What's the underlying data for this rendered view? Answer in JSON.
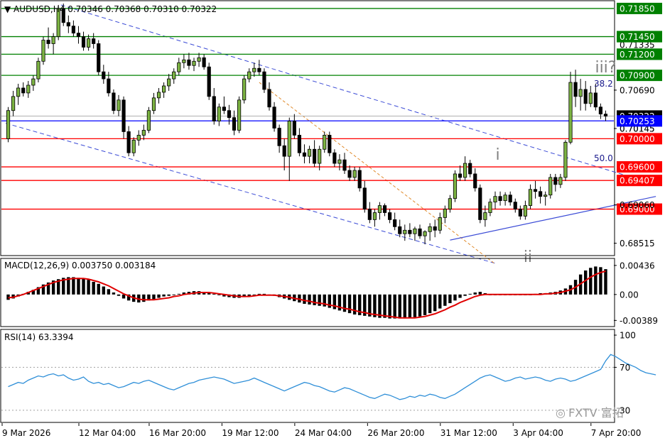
{
  "chart_data": [
    {
      "type": "candlestick",
      "symbol_header": "AUDUSD,H4",
      "ohlc_header": "0.70346 0.70368 0.70310 0.70322",
      "ylim": [
        0.6835,
        0.7195
      ],
      "price_ticks": [
        "0.70690",
        "0.70145",
        "0.69060",
        "0.68515"
      ],
      "x_labels": [
        "9 Mar 2026",
        "12 Mar 04:00",
        "16 Mar 20:00",
        "19 Mar 12:00",
        "24 Mar 04:00",
        "26 Mar 20:00",
        "31 Mar 12:00",
        "3 Apr 04:00",
        "7 Apr 20:00"
      ],
      "current_price": "0.70322",
      "horizontal_levels": [
        {
          "price": 0.7185,
          "label": "0.71850",
          "color": "#008000"
        },
        {
          "price": 0.7145,
          "label": "0.71450",
          "color": "#008000"
        },
        {
          "price": 0.712,
          "label": "0.71200",
          "color": "#008000"
        },
        {
          "price": 0.709,
          "label": "0.70900",
          "color": "#008000"
        },
        {
          "price": 0.70253,
          "label": "0.70253",
          "color": "#0000ff"
        },
        {
          "price": 0.7,
          "label": "0.70000",
          "color": "#ff0000"
        },
        {
          "price": 0.696,
          "label": "0.69600",
          "color": "#ff0000"
        },
        {
          "price": 0.69407,
          "label": "0.69407",
          "color": "#ff0000"
        },
        {
          "price": 0.69,
          "label": "0.69000",
          "color": "#ff0000"
        }
      ],
      "overlapped_tick_text": [
        "0.71335",
        "0.70145"
      ],
      "fib_labels": [
        {
          "text": "38.2",
          "price": 0.7078
        },
        {
          "text": "50.0",
          "price": 0.6972
        }
      ],
      "wave_labels": [
        {
          "text": "i",
          "price": 0.697
        },
        {
          "text": "ii",
          "price": 0.6825
        },
        {
          "text": "iii?",
          "price": 0.7094
        }
      ],
      "candles_ohlc": [
        [
          0.7,
          0.7045,
          0.6995,
          0.704
        ],
        [
          0.704,
          0.7068,
          0.7032,
          0.706
        ],
        [
          0.706,
          0.7078,
          0.7048,
          0.7072
        ],
        [
          0.7072,
          0.708,
          0.706,
          0.7065
        ],
        [
          0.7065,
          0.7082,
          0.7058,
          0.7076
        ],
        [
          0.7076,
          0.709,
          0.7068,
          0.7085
        ],
        [
          0.7085,
          0.7115,
          0.708,
          0.711
        ],
        [
          0.711,
          0.7145,
          0.7105,
          0.714
        ],
        [
          0.714,
          0.7158,
          0.7128,
          0.7135
        ],
        [
          0.7135,
          0.715,
          0.712,
          0.7145
        ],
        [
          0.7145,
          0.719,
          0.714,
          0.7185
        ],
        [
          0.7185,
          0.7192,
          0.716,
          0.7165
        ],
        [
          0.7165,
          0.7175,
          0.715,
          0.716
        ],
        [
          0.716,
          0.7168,
          0.7145,
          0.715
        ],
        [
          0.715,
          0.716,
          0.7135,
          0.7145
        ],
        [
          0.7145,
          0.7152,
          0.7125,
          0.713
        ],
        [
          0.713,
          0.7148,
          0.7125,
          0.7142
        ],
        [
          0.7142,
          0.715,
          0.7128,
          0.7135
        ],
        [
          0.7135,
          0.714,
          0.709,
          0.7095
        ],
        [
          0.7095,
          0.7105,
          0.7078,
          0.7085
        ],
        [
          0.7085,
          0.7095,
          0.706,
          0.7065
        ],
        [
          0.7065,
          0.707,
          0.7035,
          0.704
        ],
        [
          0.704,
          0.7062,
          0.7032,
          0.7055
        ],
        [
          0.7055,
          0.706,
          0.7,
          0.701
        ],
        [
          0.701,
          0.7018,
          0.6975,
          0.698
        ],
        [
          0.698,
          0.7002,
          0.6975,
          0.6998
        ],
        [
          0.6998,
          0.7012,
          0.699,
          0.7005
        ],
        [
          0.7005,
          0.702,
          0.6998,
          0.7012
        ],
        [
          0.7012,
          0.7045,
          0.7008,
          0.704
        ],
        [
          0.704,
          0.7065,
          0.7035,
          0.7058
        ],
        [
          0.7058,
          0.7072,
          0.705,
          0.7066
        ],
        [
          0.7066,
          0.708,
          0.7058,
          0.7075
        ],
        [
          0.7075,
          0.7092,
          0.7068,
          0.7085
        ],
        [
          0.7085,
          0.71,
          0.7078,
          0.7095
        ],
        [
          0.7095,
          0.7115,
          0.709,
          0.7108
        ],
        [
          0.7108,
          0.712,
          0.71,
          0.7112
        ],
        [
          0.7112,
          0.7122,
          0.7098,
          0.7104
        ],
        [
          0.7104,
          0.7115,
          0.7096,
          0.711
        ],
        [
          0.711,
          0.7122,
          0.7102,
          0.7115
        ],
        [
          0.7115,
          0.712,
          0.7098,
          0.7102
        ],
        [
          0.7102,
          0.7108,
          0.7055,
          0.706
        ],
        [
          0.706,
          0.7072,
          0.702,
          0.7025
        ],
        [
          0.7025,
          0.705,
          0.7018,
          0.7045
        ],
        [
          0.7045,
          0.706,
          0.7035,
          0.704
        ],
        [
          0.704,
          0.7048,
          0.702,
          0.703
        ],
        [
          0.703,
          0.704,
          0.7005,
          0.7012
        ],
        [
          0.7012,
          0.706,
          0.7008,
          0.7055
        ],
        [
          0.7055,
          0.709,
          0.705,
          0.7085
        ],
        [
          0.7085,
          0.71,
          0.708,
          0.7095
        ],
        [
          0.7095,
          0.7108,
          0.7088,
          0.71
        ],
        [
          0.71,
          0.7112,
          0.709,
          0.7095
        ],
        [
          0.7095,
          0.71,
          0.7065,
          0.707
        ],
        [
          0.707,
          0.708,
          0.704,
          0.7045
        ],
        [
          0.7045,
          0.7052,
          0.701,
          0.7015
        ],
        [
          0.7015,
          0.702,
          0.698,
          0.699
        ],
        [
          0.699,
          0.7,
          0.6955,
          0.6975
        ],
        [
          0.6975,
          0.703,
          0.694,
          0.7025
        ],
        [
          0.7025,
          0.7035,
          0.7,
          0.7005
        ],
        [
          0.7005,
          0.7015,
          0.6975,
          0.698
        ],
        [
          0.698,
          0.6992,
          0.6965,
          0.6975
        ],
        [
          0.6975,
          0.699,
          0.6965,
          0.6985
        ],
        [
          0.6985,
          0.6998,
          0.696,
          0.6965
        ],
        [
          0.6965,
          0.699,
          0.6955,
          0.6985
        ],
        [
          0.6985,
          0.701,
          0.698,
          0.7005
        ],
        [
          0.7005,
          0.701,
          0.6975,
          0.698
        ],
        [
          0.698,
          0.6985,
          0.696,
          0.6965
        ],
        [
          0.6965,
          0.6978,
          0.6955,
          0.697
        ],
        [
          0.697,
          0.698,
          0.695,
          0.6955
        ],
        [
          0.6955,
          0.6962,
          0.694,
          0.6945
        ],
        [
          0.6945,
          0.696,
          0.694,
          0.6955
        ],
        [
          0.6955,
          0.696,
          0.6925,
          0.693
        ],
        [
          0.693,
          0.694,
          0.6895,
          0.69
        ],
        [
          0.69,
          0.691,
          0.688,
          0.6885
        ],
        [
          0.6885,
          0.69,
          0.6875,
          0.6895
        ],
        [
          0.6895,
          0.691,
          0.6885,
          0.6905
        ],
        [
          0.6905,
          0.6908,
          0.689,
          0.6895
        ],
        [
          0.6895,
          0.69,
          0.688,
          0.6885
        ],
        [
          0.6885,
          0.6895,
          0.687,
          0.6875
        ],
        [
          0.6875,
          0.6885,
          0.686,
          0.6865
        ],
        [
          0.6865,
          0.6878,
          0.6855,
          0.687
        ],
        [
          0.687,
          0.688,
          0.686,
          0.6865
        ],
        [
          0.6865,
          0.6875,
          0.6855,
          0.6872
        ],
        [
          0.6872,
          0.6878,
          0.6858,
          0.6862
        ],
        [
          0.6862,
          0.687,
          0.685,
          0.6868
        ],
        [
          0.6868,
          0.688,
          0.6855,
          0.6875
        ],
        [
          0.6875,
          0.6885,
          0.686,
          0.687
        ],
        [
          0.687,
          0.6895,
          0.6865,
          0.6888
        ],
        [
          0.6888,
          0.6905,
          0.688,
          0.69
        ],
        [
          0.69,
          0.692,
          0.6895,
          0.6915
        ],
        [
          0.6915,
          0.6955,
          0.691,
          0.695
        ],
        [
          0.695,
          0.6962,
          0.694,
          0.6945
        ],
        [
          0.6945,
          0.6975,
          0.694,
          0.6965
        ],
        [
          0.6965,
          0.697,
          0.6945,
          0.695
        ],
        [
          0.695,
          0.6958,
          0.6925,
          0.693
        ],
        [
          0.693,
          0.6935,
          0.688,
          0.6885
        ],
        [
          0.6885,
          0.6905,
          0.6875,
          0.6895
        ],
        [
          0.6895,
          0.6915,
          0.689,
          0.691
        ],
        [
          0.691,
          0.6925,
          0.69,
          0.6918
        ],
        [
          0.6918,
          0.6925,
          0.6905,
          0.6912
        ],
        [
          0.6912,
          0.6924,
          0.6905,
          0.692
        ],
        [
          0.692,
          0.6925,
          0.6905,
          0.691
        ],
        [
          0.691,
          0.6915,
          0.6895,
          0.69
        ],
        [
          0.69,
          0.6905,
          0.6885,
          0.689
        ],
        [
          0.689,
          0.6912,
          0.6885,
          0.6905
        ],
        [
          0.6905,
          0.6935,
          0.69,
          0.6928
        ],
        [
          0.6928,
          0.694,
          0.6915,
          0.6925
        ],
        [
          0.6925,
          0.6932,
          0.6908,
          0.6918
        ],
        [
          0.6918,
          0.6925,
          0.6905,
          0.692
        ],
        [
          0.692,
          0.695,
          0.6915,
          0.6945
        ],
        [
          0.6945,
          0.695,
          0.6925,
          0.6935
        ],
        [
          0.6935,
          0.695,
          0.693,
          0.6945
        ],
        [
          0.6945,
          0.6998,
          0.694,
          0.6995
        ],
        [
          0.6995,
          0.7095,
          0.6992,
          0.708
        ],
        [
          0.708,
          0.7098,
          0.7045,
          0.706
        ],
        [
          0.706,
          0.7085,
          0.704,
          0.707
        ],
        [
          0.707,
          0.7082,
          0.704,
          0.705
        ],
        [
          0.705,
          0.7075,
          0.7045,
          0.7065
        ],
        [
          0.7065,
          0.7078,
          0.704,
          0.7045
        ],
        [
          0.7045,
          0.705,
          0.7028,
          0.7035
        ],
        [
          0.7035,
          0.704,
          0.7025,
          0.7032
        ]
      ]
    },
    {
      "type": "histogram",
      "header": "MACD(12,26,9) 0.003750 0.003184",
      "ylim": [
        -0.0046,
        0.0052
      ],
      "y_ticks": [
        "0.00436",
        "0.00",
        "-0.00389"
      ],
      "histogram": [
        -0.0008,
        -0.0006,
        -0.0003,
        0.0001,
        0.0004,
        0.0007,
        0.0011,
        0.0015,
        0.0018,
        0.0021,
        0.0023,
        0.0025,
        0.0026,
        0.0026,
        0.0025,
        0.0024,
        0.0022,
        0.0019,
        0.0016,
        0.0012,
        0.0008,
        0.0003,
        -0.0002,
        -0.0006,
        -0.0009,
        -0.0011,
        -0.0012,
        -0.0011,
        -0.0009,
        -0.0007,
        -0.0005,
        -0.0003,
        -0.0002,
        0.0,
        0.0001,
        0.0003,
        0.0004,
        0.0005,
        0.0005,
        0.0004,
        0.0003,
        0.0001,
        -0.0001,
        -0.0003,
        -0.0004,
        -0.0005,
        -0.0005,
        -0.0004,
        -0.0002,
        0.0,
        0.0001,
        0.0001,
        0.0,
        -0.0002,
        -0.0004,
        -0.0006,
        -0.0008,
        -0.001,
        -0.0012,
        -0.0014,
        -0.0015,
        -0.0016,
        -0.0017,
        -0.0018,
        -0.002,
        -0.0022,
        -0.0024,
        -0.0026,
        -0.0028,
        -0.003,
        -0.0031,
        -0.0032,
        -0.0033,
        -0.0034,
        -0.0035,
        -0.0035,
        -0.0036,
        -0.0036,
        -0.0036,
        -0.0036,
        -0.0035,
        -0.0034,
        -0.0033,
        -0.0031,
        -0.0028,
        -0.0025,
        -0.0021,
        -0.0017,
        -0.0013,
        -0.0009,
        -0.0005,
        -0.0002,
        0.0001,
        0.0003,
        0.0004,
        0.0002,
        0.0,
        -0.0001,
        -0.0001,
        0.0,
        0.0,
        0.0,
        -0.0001,
        -0.0001,
        0.0,
        0.0001,
        0.0002,
        0.0002,
        0.0003,
        0.0004,
        0.0006,
        0.0009,
        0.0014,
        0.0022,
        0.003,
        0.0036,
        0.004,
        0.0042,
        0.0041,
        0.0038
      ],
      "signal": [
        -0.0005,
        -0.0004,
        -0.0002,
        0.0,
        0.0003,
        0.0006,
        0.0009,
        0.0012,
        0.0015,
        0.0018,
        0.002,
        0.0022,
        0.0023,
        0.0024,
        0.0024,
        0.0024,
        0.0023,
        0.0021,
        0.0019,
        0.0016,
        0.0013,
        0.0009,
        0.0005,
        0.0001,
        -0.0002,
        -0.0005,
        -0.0007,
        -0.0008,
        -0.0008,
        -0.0008,
        -0.0007,
        -0.0006,
        -0.0005,
        -0.0003,
        -0.0002,
        0.0,
        0.0001,
        0.0002,
        0.0003,
        0.0003,
        0.0003,
        0.0002,
        0.0001,
        0.0,
        -0.0001,
        -0.0002,
        -0.0003,
        -0.0003,
        -0.0003,
        -0.0002,
        -0.0001,
        -0.0001,
        -0.0001,
        -0.0001,
        -0.0002,
        -0.0003,
        -0.0004,
        -0.0006,
        -0.0007,
        -0.0009,
        -0.001,
        -0.0012,
        -0.0013,
        -0.0014,
        -0.0016,
        -0.0017,
        -0.0019,
        -0.0021,
        -0.0022,
        -0.0024,
        -0.0026,
        -0.0027,
        -0.0029,
        -0.003,
        -0.0031,
        -0.0032,
        -0.0033,
        -0.0034,
        -0.0035,
        -0.0035,
        -0.0035,
        -0.0035,
        -0.0034,
        -0.0033,
        -0.0031,
        -0.0029,
        -0.0026,
        -0.0023,
        -0.0019,
        -0.0016,
        -0.0012,
        -0.0009,
        -0.0006,
        -0.0003,
        -0.0001,
        0.0,
        0.0,
        0.0,
        0.0,
        0.0,
        0.0,
        0.0,
        0.0,
        0.0,
        0.0,
        0.0,
        0.0,
        0.0001,
        0.0001,
        0.0002,
        0.0003,
        0.0005,
        0.0007,
        0.0011,
        0.0016,
        0.0021,
        0.0026,
        0.003,
        0.0033,
        0.0035
      ]
    },
    {
      "type": "line",
      "header": "RSI(14) 63.3394",
      "ylim": [
        20,
        104
      ],
      "y_ticks": [
        "100",
        "70",
        "30"
      ],
      "levels": [
        70,
        30
      ],
      "values": [
        52,
        54,
        56,
        55,
        58,
        60,
        62,
        61,
        63,
        64,
        62,
        63,
        60,
        58,
        59,
        61,
        57,
        55,
        56,
        54,
        55,
        53,
        51,
        52,
        54,
        56,
        55,
        57,
        58,
        56,
        54,
        52,
        50,
        49,
        51,
        53,
        55,
        56,
        58,
        59,
        60,
        61,
        60,
        59,
        57,
        55,
        56,
        57,
        58,
        60,
        58,
        56,
        54,
        52,
        50,
        48,
        50,
        52,
        54,
        56,
        55,
        53,
        52,
        50,
        48,
        47,
        49,
        51,
        50,
        48,
        46,
        44,
        42,
        41,
        43,
        45,
        44,
        42,
        40,
        41,
        43,
        42,
        44,
        43,
        45,
        44,
        42,
        41,
        43,
        45,
        48,
        51,
        54,
        57,
        60,
        62,
        63,
        61,
        59,
        57,
        58,
        60,
        61,
        59,
        60,
        61,
        60,
        58,
        57,
        59,
        60,
        59,
        57,
        58,
        60,
        62,
        64,
        66,
        68,
        76,
        82,
        80,
        77,
        74,
        72,
        70,
        67,
        65,
        64,
        63
      ]
    },
    {
      "watermark": "FXTV 富拓"
    }
  ],
  "colors": {
    "bull": "#7cb342",
    "bear": "#000000",
    "green_level": "#008000",
    "red_level": "#ff0000",
    "blue_level": "#0000ff",
    "channel": "#3b4bd6",
    "orange_dashed": "#e08a2b",
    "macd_bar": "#000000",
    "macd_signal": "#e00000",
    "rsi_line": "#2f8fd8",
    "current_label_bg": "#000000"
  }
}
